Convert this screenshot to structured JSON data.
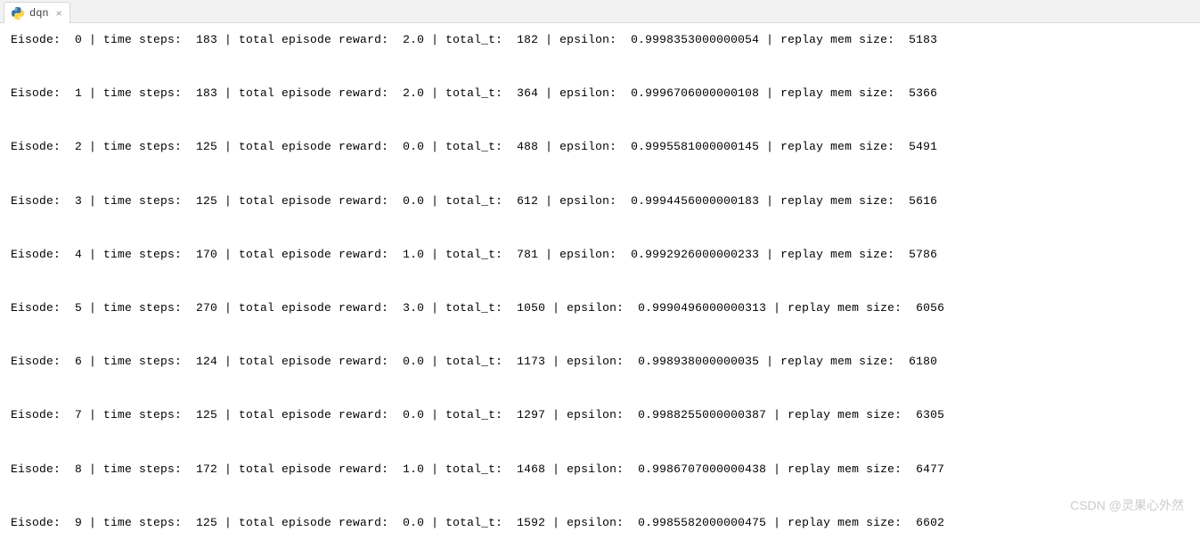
{
  "tab": {
    "title": "dqn",
    "close_glyph": "×"
  },
  "labels": {
    "episode": "Eisode:",
    "steps": "time steps:",
    "reward": "total episode reward:",
    "total_t": "total_t:",
    "epsilon": "epsilon:",
    "mem": "replay mem size:",
    "sep": "|"
  },
  "chart_data": {
    "type": "table",
    "columns": [
      "episode",
      "time_steps",
      "total_episode_reward",
      "total_t",
      "epsilon",
      "replay_mem_size"
    ],
    "rows": [
      {
        "episode": 0,
        "time_steps": 183,
        "total_episode_reward": "2.0",
        "total_t": 182,
        "epsilon": "0.9998353000000054",
        "replay_mem_size": 5183
      },
      {
        "episode": 1,
        "time_steps": 183,
        "total_episode_reward": "2.0",
        "total_t": 364,
        "epsilon": "0.9996706000000108",
        "replay_mem_size": 5366
      },
      {
        "episode": 2,
        "time_steps": 125,
        "total_episode_reward": "0.0",
        "total_t": 488,
        "epsilon": "0.9995581000000145",
        "replay_mem_size": 5491
      },
      {
        "episode": 3,
        "time_steps": 125,
        "total_episode_reward": "0.0",
        "total_t": 612,
        "epsilon": "0.9994456000000183",
        "replay_mem_size": 5616
      },
      {
        "episode": 4,
        "time_steps": 170,
        "total_episode_reward": "1.0",
        "total_t": 781,
        "epsilon": "0.9992926000000233",
        "replay_mem_size": 5786
      },
      {
        "episode": 5,
        "time_steps": 270,
        "total_episode_reward": "3.0",
        "total_t": 1050,
        "epsilon": "0.9990496000000313",
        "replay_mem_size": 6056
      },
      {
        "episode": 6,
        "time_steps": 124,
        "total_episode_reward": "0.0",
        "total_t": 1173,
        "epsilon": "0.998938000000035",
        "replay_mem_size": 6180
      },
      {
        "episode": 7,
        "time_steps": 125,
        "total_episode_reward": "0.0",
        "total_t": 1297,
        "epsilon": "0.9988255000000387",
        "replay_mem_size": 6305
      },
      {
        "episode": 8,
        "time_steps": 172,
        "total_episode_reward": "1.0",
        "total_t": 1468,
        "epsilon": "0.9986707000000438",
        "replay_mem_size": 6477
      },
      {
        "episode": 9,
        "time_steps": 125,
        "total_episode_reward": "0.0",
        "total_t": 1592,
        "epsilon": "0.9985582000000475",
        "replay_mem_size": 6602
      }
    ]
  },
  "watermark": "CSDN @灵果心外然"
}
